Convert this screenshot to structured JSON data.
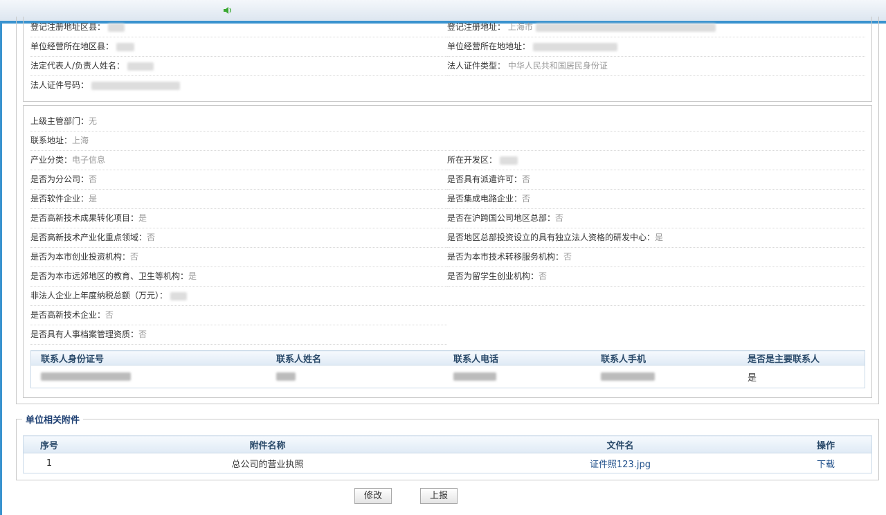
{
  "basic": {
    "reg_district_label": "登记注册地址区县：",
    "reg_address_label": "登记注册地址：",
    "reg_address_value": "上海市",
    "op_district_label": "单位经营所在地区县：",
    "op_address_label": "单位经营所在地地址：",
    "legal_rep_label": "法定代表人/负责人姓名：",
    "cert_type_label": "法人证件类型：",
    "cert_type_value": "中华人民共和国居民身份证",
    "cert_no_label": "法人证件号码："
  },
  "info": {
    "rows": [
      {
        "label": "上级主管部门：",
        "value": "无"
      },
      {
        "label": "联系地址：",
        "value": "上海"
      },
      {
        "label": "产业分类：",
        "value": "电子信息"
      },
      {
        "label": "所在开发区：",
        "value": ""
      },
      {
        "label": "是否为分公司：",
        "value": "否"
      },
      {
        "label": "是否具有派遣许可：",
        "value": "否"
      },
      {
        "label": "是否软件企业：",
        "value": "是"
      },
      {
        "label": "是否集成电路企业：",
        "value": "否"
      },
      {
        "label": "是否高新技术成果转化项目：",
        "value": "是"
      },
      {
        "label": "是否在沪跨国公司地区总部：",
        "value": "否"
      },
      {
        "label": "是否高新技术产业化重点领域：",
        "value": "否"
      },
      {
        "label": "是否地区总部投资设立的具有独立法人资格的研发中心：",
        "value": "是"
      },
      {
        "label": "是否为本市创业投资机构：",
        "value": "否"
      },
      {
        "label": "是否为本市技术转移服务机构：",
        "value": "否"
      },
      {
        "label": "是否为本市远郊地区的教育、卫生等机构：",
        "value": "是"
      },
      {
        "label": "是否为留学生创业机构：",
        "value": "否"
      },
      {
        "label": "非法人企业上年度纳税总额（万元）：",
        "value": ""
      },
      {
        "label": "是否高新技术企业：",
        "value": "否"
      },
      {
        "label": "是否具有人事档案管理资质：",
        "value": "否"
      }
    ]
  },
  "contacts": {
    "headers": [
      "联系人身份证号",
      "联系人姓名",
      "联系人电话",
      "联系人手机",
      "是否是主要联系人"
    ],
    "rows": [
      {
        "is_primary": "是"
      }
    ]
  },
  "attachments": {
    "legend": "单位相关附件",
    "headers": [
      "序号",
      "附件名称",
      "文件名",
      "操作"
    ],
    "rows": [
      {
        "no": "1",
        "name": "总公司的营业执照",
        "file": "证件照123.jpg",
        "action": "下载"
      }
    ]
  },
  "buttons": {
    "modify": "修改",
    "report": "上报"
  },
  "colors": {
    "accent": "#3a93cf",
    "header_text": "#2a4a6a",
    "link": "#1f4f8a",
    "value_grey": "#999999"
  }
}
